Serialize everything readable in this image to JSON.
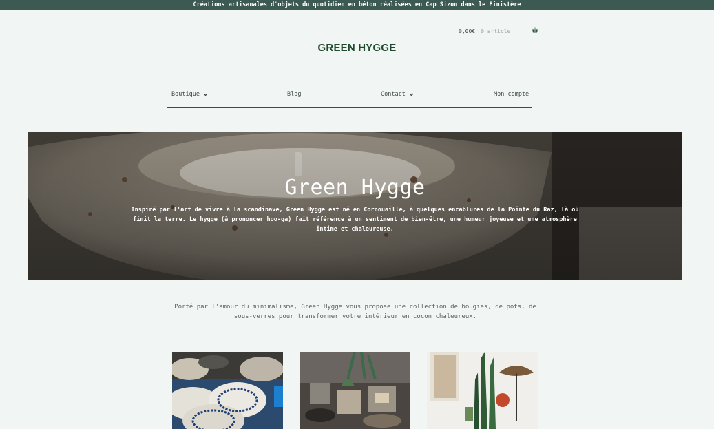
{
  "announcement": "Créations artisanales d'objets du quotidien en béton réalisées en Cap Sizun dans le Finistère",
  "cart": {
    "price": "0,00€",
    "count": "0 article",
    "icon": "basket-icon"
  },
  "logo": "GREEN HYGGE",
  "nav": {
    "items": [
      {
        "label": "Boutique",
        "has_dropdown": true
      },
      {
        "label": "Blog",
        "has_dropdown": false
      },
      {
        "label": "Contact",
        "has_dropdown": true
      },
      {
        "label": "Mon compte",
        "has_dropdown": false
      }
    ]
  },
  "hero": {
    "title": "Green Hygge",
    "text": "Inspiré par l'art de vivre à la scandinave, Green Hygge est né en Cornouaille, à quelques encablures de la Pointe du Raz, là où finit la terre. Le hygge (à prononcer hoo-ga) fait référence à un sentiment de bien-être, une humeur joyeuse et une atmosphère intime et chaleureuse."
  },
  "intro": "Porté par l'amour du minimalisme, Green Hygge vous propose une collection de bougies, de pots, de sous-verres pour transformer votre intérieur en cocon chaleureux.",
  "colors": {
    "topbar": "#3d5a52",
    "background": "#f1f5f3",
    "logo": "#1e4a2e",
    "text": "#3f4a46"
  }
}
